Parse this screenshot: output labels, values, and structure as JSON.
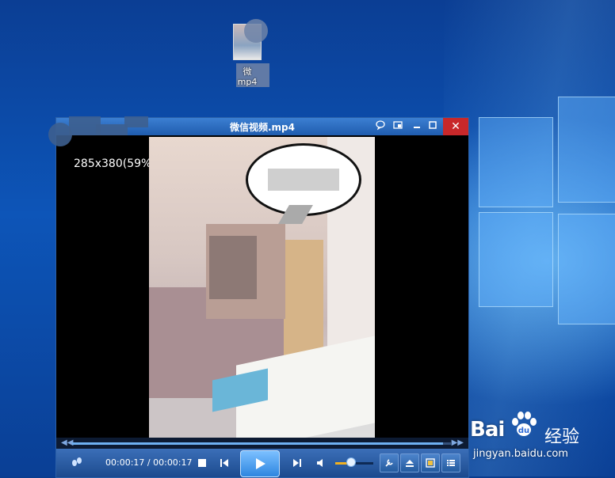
{
  "desktop": {
    "icon": {
      "label_line1": "微",
      "label_line2": "mp4"
    }
  },
  "player": {
    "title": "微信视频.mp4",
    "resolution": "285x380(59%)",
    "time_current": "00:00:17",
    "time_separator": " / ",
    "time_total": "00:00:17",
    "seek_progress_pct": 98,
    "volume_pct": 40,
    "titlebar_icons": [
      "chat-icon",
      "screen-icon",
      "minimize-icon",
      "maximize-icon",
      "close-icon"
    ],
    "control_icons": [
      "footprint-icon",
      "stop-icon",
      "prev-icon",
      "play-icon",
      "next-icon",
      "volume-icon",
      "wrench-icon",
      "eject-icon",
      "screen-icon",
      "list-icon"
    ]
  },
  "watermark": {
    "brand": "Bai",
    "brand_tail": "经验",
    "sub": "jingyan.baidu.com"
  },
  "colors": {
    "titlebar": "#1f5cae",
    "close": "#c8282a",
    "accent": "#2d86e0",
    "volume": "#f0b020"
  }
}
